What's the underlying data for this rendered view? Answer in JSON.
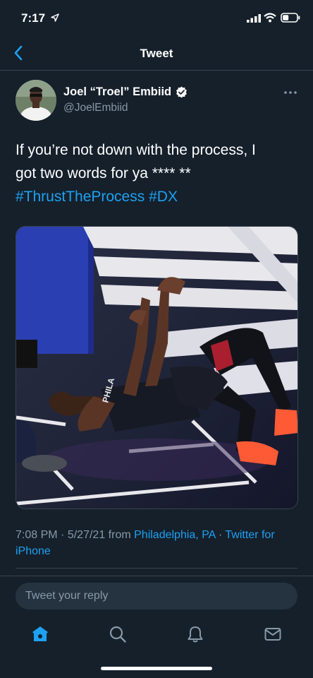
{
  "status": {
    "time": "7:17"
  },
  "nav": {
    "title": "Tweet"
  },
  "tweet": {
    "display_name": "Joel “Troel” Embiid",
    "handle": "@JoelEmbiid",
    "text_line1": "If you’re not down with the process, I",
    "text_line2": "got two words for ya **** **",
    "hashtag1": "#ThrustTheProcess",
    "hashtag2": "#DX",
    "time": "7:08 PM",
    "date": "5/27/21",
    "from_word": "from",
    "location": "Philadelphia, PA",
    "source_line1": "Twitter for",
    "source_line2": "iPhone",
    "separator": "·"
  },
  "reply": {
    "placeholder": "Tweet your reply"
  },
  "tabs": [
    "home-icon",
    "search-icon",
    "notifications-icon",
    "messages-icon"
  ],
  "colors": {
    "background": "#15202b",
    "accent": "#1da1f2",
    "secondary_text": "#8899a6",
    "divider": "#38444d"
  }
}
